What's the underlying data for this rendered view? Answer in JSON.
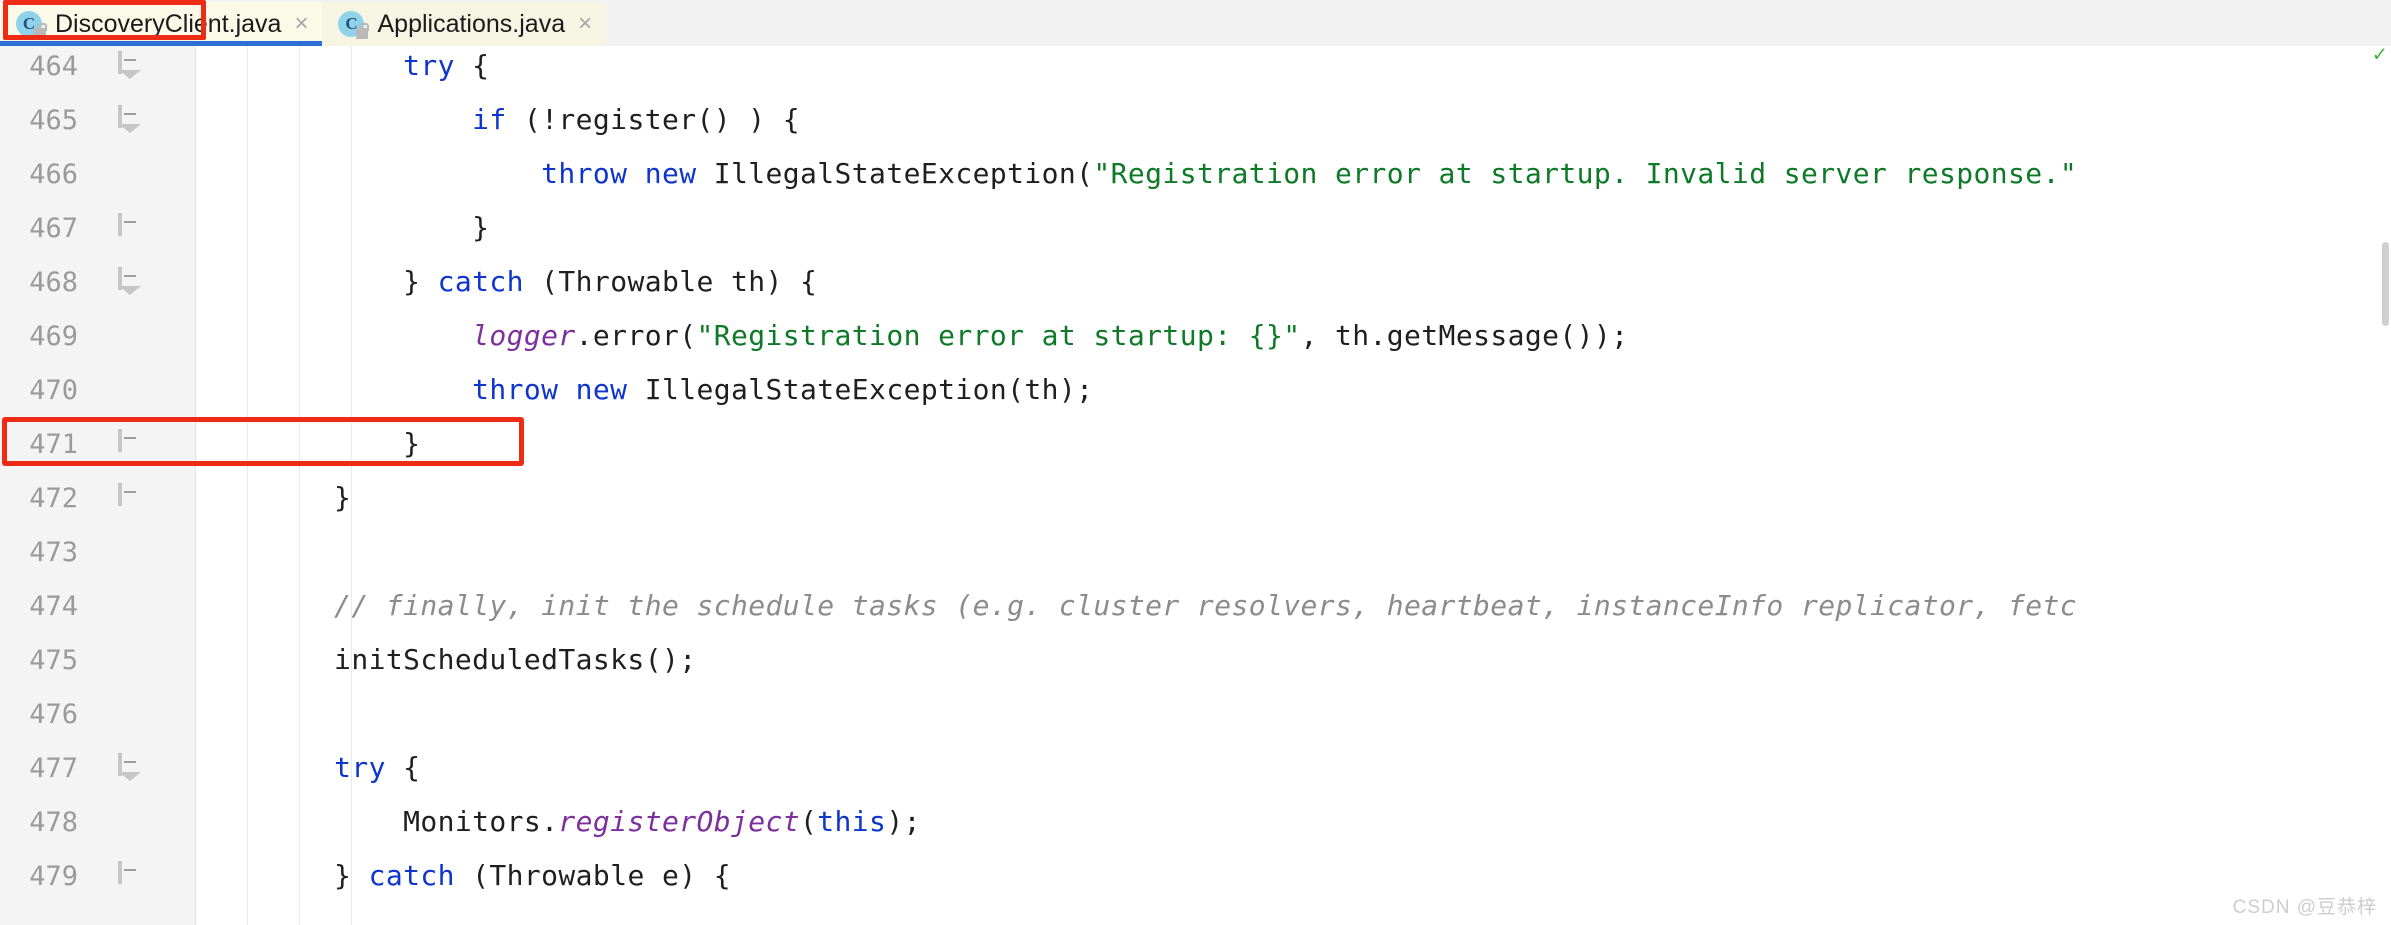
{
  "tabs": [
    {
      "label": "DiscoveryClient.java",
      "icon": "java-class-icon",
      "icon_letter": "C",
      "close": "×",
      "active": true
    },
    {
      "label": "Applications.java",
      "icon": "java-class-icon",
      "icon_letter": "C",
      "close": "×",
      "active": false
    }
  ],
  "colors": {
    "keyword": "#0f35cf",
    "string": "#0e7a28",
    "comment": "#8c8c8c",
    "field": "#7d2f9e",
    "highlight_box": "#ee2b14",
    "active_tab_underline": "#2d6fd4",
    "tab_background": "#f6f5e4",
    "gutter_background": "#f4f4f4"
  },
  "editor": {
    "first_line_number": 464,
    "lines": [
      {
        "number": "464",
        "fold": "collapse",
        "tokens": [
          {
            "t": "            ",
            "c": ""
          },
          {
            "t": "try",
            "c": "kw"
          },
          {
            "t": " {",
            "c": ""
          }
        ]
      },
      {
        "number": "465",
        "fold": "collapse",
        "tokens": [
          {
            "t": "                ",
            "c": ""
          },
          {
            "t": "if",
            "c": "kw"
          },
          {
            "t": " (!register() ) {",
            "c": ""
          }
        ]
      },
      {
        "number": "466",
        "fold": "none",
        "tokens": [
          {
            "t": "                    ",
            "c": ""
          },
          {
            "t": "throw new",
            "c": "kw"
          },
          {
            "t": " IllegalStateException(",
            "c": ""
          },
          {
            "t": "\"Registration error at startup. Invalid server response.\"",
            "c": "str"
          }
        ]
      },
      {
        "number": "467",
        "fold": "plain",
        "tokens": [
          {
            "t": "                }",
            "c": ""
          }
        ]
      },
      {
        "number": "468",
        "fold": "collapse",
        "tokens": [
          {
            "t": "            } ",
            "c": ""
          },
          {
            "t": "catch",
            "c": "kw"
          },
          {
            "t": " (Throwable th) {",
            "c": ""
          }
        ]
      },
      {
        "number": "469",
        "fold": "none",
        "tokens": [
          {
            "t": "                ",
            "c": ""
          },
          {
            "t": "logger",
            "c": "fld"
          },
          {
            "t": ".error(",
            "c": ""
          },
          {
            "t": "\"Registration error at startup: {}\"",
            "c": "str"
          },
          {
            "t": ", th.getMessage());",
            "c": ""
          }
        ]
      },
      {
        "number": "470",
        "fold": "none",
        "tokens": [
          {
            "t": "                ",
            "c": ""
          },
          {
            "t": "throw new",
            "c": "kw"
          },
          {
            "t": " IllegalStateException(th);",
            "c": ""
          }
        ]
      },
      {
        "number": "471",
        "fold": "plain",
        "tokens": [
          {
            "t": "            }",
            "c": ""
          }
        ]
      },
      {
        "number": "472",
        "fold": "plain",
        "tokens": [
          {
            "t": "        }",
            "c": ""
          }
        ]
      },
      {
        "number": "473",
        "fold": "none",
        "tokens": [
          {
            "t": "",
            "c": ""
          }
        ]
      },
      {
        "number": "474",
        "fold": "none",
        "tokens": [
          {
            "t": "        // finally, init the schedule tasks (e.g. cluster resolvers, heartbeat, instanceInfo replicator, fetc",
            "c": "cmt"
          }
        ]
      },
      {
        "number": "475",
        "fold": "none",
        "highlighted": true,
        "tokens": [
          {
            "t": "        initScheduledTasks();",
            "c": ""
          }
        ]
      },
      {
        "number": "476",
        "fold": "none",
        "tokens": [
          {
            "t": "",
            "c": ""
          }
        ]
      },
      {
        "number": "477",
        "fold": "collapse",
        "tokens": [
          {
            "t": "        ",
            "c": ""
          },
          {
            "t": "try",
            "c": "kw"
          },
          {
            "t": " {",
            "c": ""
          }
        ]
      },
      {
        "number": "478",
        "fold": "none",
        "tokens": [
          {
            "t": "            Monitors.",
            "c": ""
          },
          {
            "t": "registerObject",
            "c": "fld"
          },
          {
            "t": "(",
            "c": ""
          },
          {
            "t": "this",
            "c": "kw"
          },
          {
            "t": ");",
            "c": ""
          }
        ]
      },
      {
        "number": "479",
        "fold": "plain",
        "tokens": [
          {
            "t": "        } ",
            "c": ""
          },
          {
            "t": "catch",
            "c": "kw"
          },
          {
            "t": " (Throwable e) {",
            "c": ""
          }
        ]
      }
    ]
  },
  "watermark": "CSDN @豆恭梓"
}
